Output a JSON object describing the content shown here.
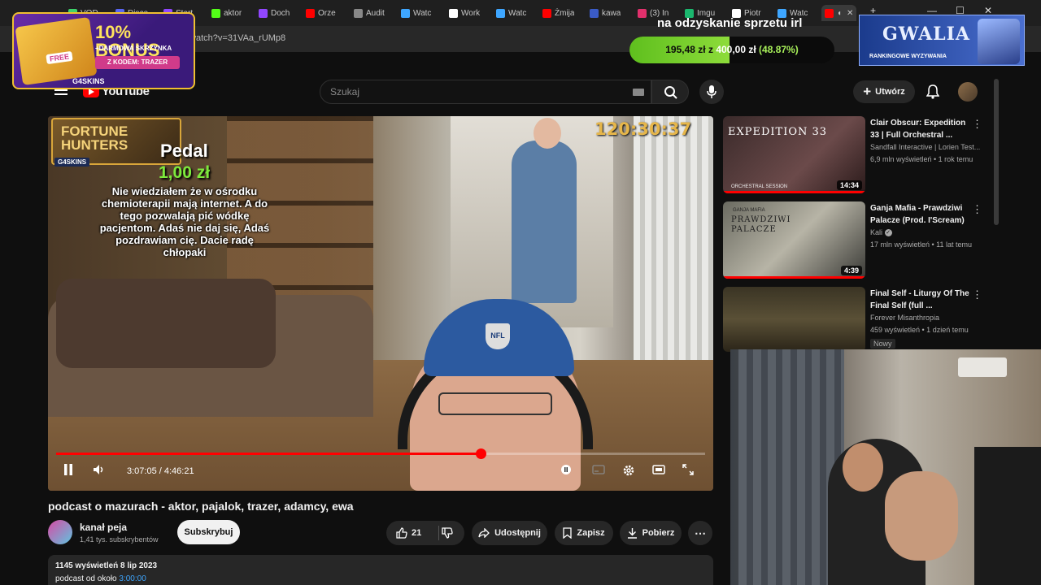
{
  "browser": {
    "tabs": [
      {
        "label": "VOD",
        "color": "#3dd36a"
      },
      {
        "label": "Disco",
        "color": "#5865f2"
      },
      {
        "label": "Start",
        "color": "#9146ff"
      },
      {
        "label": "aktor",
        "color": "#53fc18"
      },
      {
        "label": "Doch",
        "color": "#9146ff"
      },
      {
        "label": "Orze",
        "color": "#ff0000"
      },
      {
        "label": "Audit",
        "color": "#888888"
      },
      {
        "label": "Watc",
        "color": "#3ea6ff"
      },
      {
        "label": "Work",
        "color": "#ffffff"
      },
      {
        "label": "Watc",
        "color": "#3ea6ff"
      },
      {
        "label": "Żmija",
        "color": "#ff0000"
      },
      {
        "label": "kawa",
        "color": "#3a5bc7"
      },
      {
        "label": "(3) In",
        "color": "#e1306c"
      },
      {
        "label": "Imgu",
        "color": "#1bb76e"
      },
      {
        "label": "Piotr",
        "color": "#ffffff"
      },
      {
        "label": "Watc",
        "color": "#3ea6ff"
      }
    ],
    "url": "/watch?v=31VAa_rUMp8"
  },
  "overlays": {
    "bonus": {
      "title": "10% BONUS",
      "subtitle": "+DARMOWA SKRZYNKA",
      "code": "Z KODEM: TRAZER",
      "free": "FREE",
      "brand": "G4SKINS"
    },
    "goal": {
      "title": "na odzyskanie sprzetu irl",
      "current": "195,48 zł",
      "separator": "z",
      "target": "400,00 zł",
      "percent_label": "(48.87%)",
      "progress": 0.4887
    },
    "gwalia": {
      "title": "GWALIA",
      "subtitle": "RANKINGOWE WYZYWANIA"
    }
  },
  "youtube": {
    "logo": "YouTube",
    "search_placeholder": "Szukaj",
    "create_label": "Utwórz"
  },
  "player": {
    "overlay_logo": "FORTUNE HUNTERS",
    "overlay_logo_sub": "G4SKINS",
    "donation_name": "Pedal",
    "donation_amount": "1,00 zł",
    "donation_message": "Nie wiedziałem że w ośrodku chemioterapii mają internet. A do tego pozwalają pić wódkę pacjentom. Adaś nie daj się, Adaś pozdrawiam cię. Dacie radę chłopaki",
    "stream_timer": "120:30:37",
    "cap_logo": "NFL",
    "time_display": "3:07:05 / 4:46:21",
    "progress": 0.654
  },
  "video": {
    "title": "podcast o mazurach - aktor, pajalok, trazer, adamcy, ewa",
    "channel_name": "kanał peja",
    "channel_subs": "1,41 tys. subskrybentów",
    "subscribe_label": "Subskrybuj",
    "likes": "21",
    "share_label": "Udostępnij",
    "save_label": "Zapisz",
    "download_label": "Pobierz",
    "views_date": "1145 wyświetleń  8 lip 2023",
    "desc_prefix": "podcast od około ",
    "desc_timestamp": "3:00:00"
  },
  "recommendations": [
    {
      "title": "Clair Obscur: Expedition 33 | Full Orchestral ...",
      "channel": "Sandfall Interactive | Lorien Test...",
      "meta": "6,9 mln wyświetleń • 1 rok temu",
      "duration": "14:34",
      "thumb_text": "EXPEDITION 33",
      "thumb_sub": "ORCHESTRAL SESSION"
    },
    {
      "title": "Ganja Mafia - Prawdziwi Palacze (Prod. I'Scream)",
      "channel": "Kali",
      "meta": "17 mln wyświetleń • 11 lat temu",
      "duration": "4:39",
      "thumb_text": "PRAWDZIWI PALACZE",
      "thumb_sub": "GANJA MAFIA"
    },
    {
      "title": "Final Self - Liturgy Of The Final Self (full ...",
      "channel": "Forever Misanthropia",
      "meta": "459 wyświetleń • 1 dzień temu",
      "badge": "Nowy"
    }
  ]
}
